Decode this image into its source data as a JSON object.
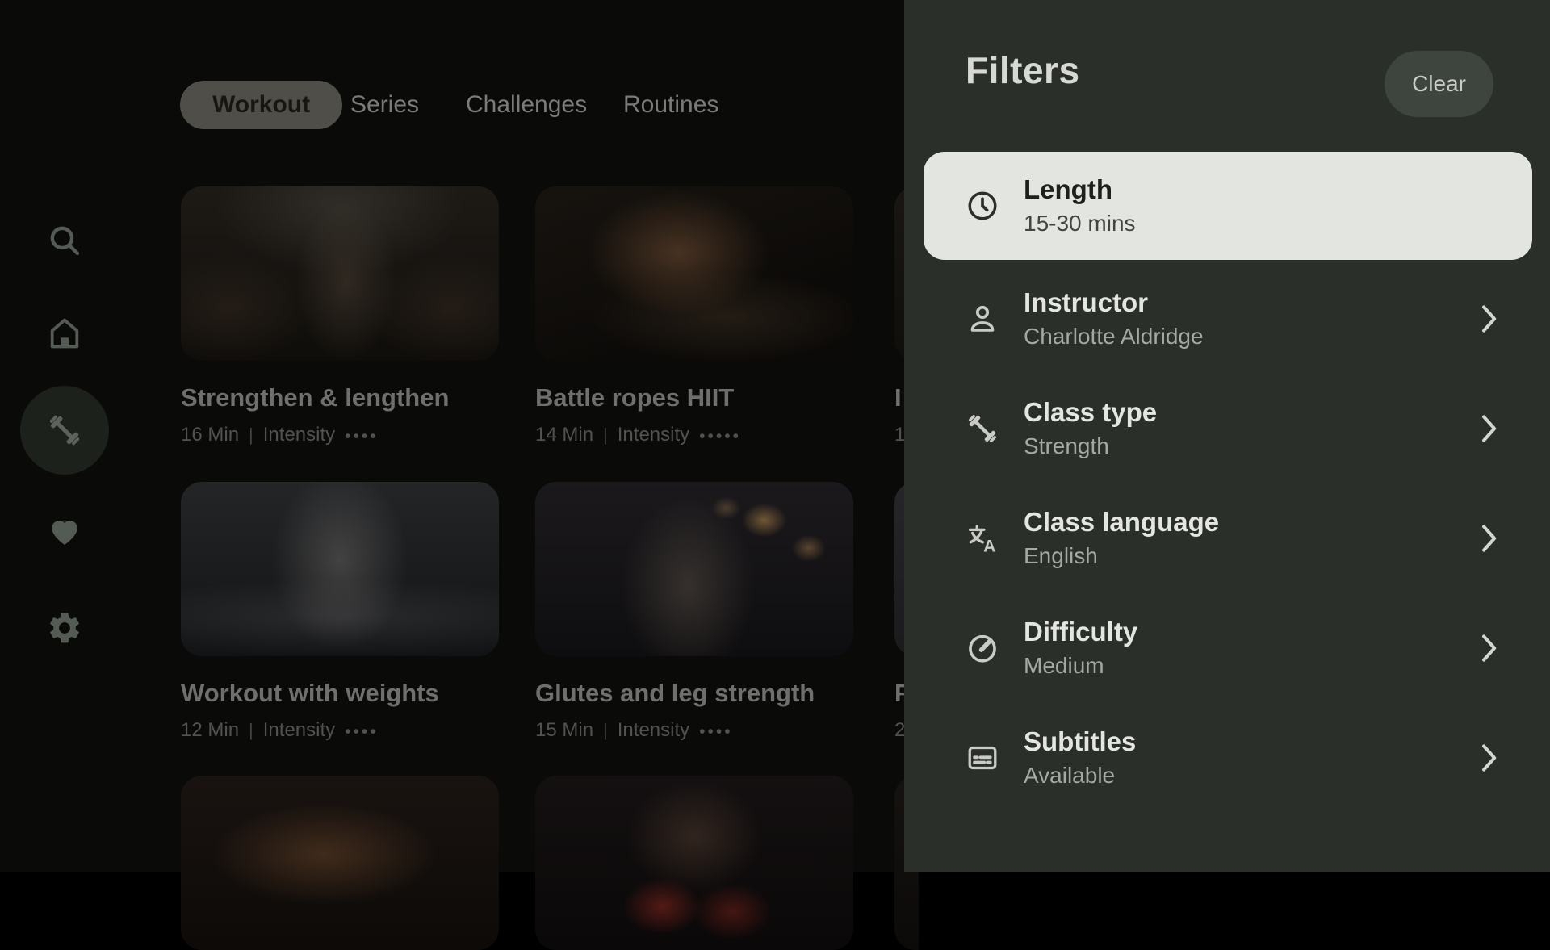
{
  "sidebar": {
    "items": [
      {
        "icon": "search",
        "active": false
      },
      {
        "icon": "home",
        "active": false
      },
      {
        "icon": "dumbbell",
        "active": true
      },
      {
        "icon": "heart",
        "active": false
      },
      {
        "icon": "settings",
        "active": false
      }
    ]
  },
  "tabs": [
    {
      "label": "Workout",
      "active": true
    },
    {
      "label": "Series",
      "active": false
    },
    {
      "label": "Challenges",
      "active": false
    },
    {
      "label": "Routines",
      "active": false
    }
  ],
  "cards": [
    {
      "title": "Strengthen & lengthen",
      "duration": "16 Min",
      "separator": "|",
      "intensity_label": "Intensity",
      "dots": 4
    },
    {
      "title": "Battle ropes HIIT",
      "duration": "14 Min",
      "separator": "|",
      "intensity_label": "Intensity",
      "dots": 5
    },
    {
      "title": "Workout with weights",
      "duration": "12 Min",
      "separator": "|",
      "intensity_label": "Intensity",
      "dots": 4
    },
    {
      "title": "Glutes and leg strength",
      "duration": "15 Min",
      "separator": "|",
      "intensity_label": "Intensity",
      "dots": 4
    },
    {
      "title_fragment": "I",
      "meta_fragment": "1"
    },
    {
      "title_fragment": "F",
      "meta_fragment": "2"
    }
  ],
  "filters_panel": {
    "title": "Filters",
    "clear_label": "Clear",
    "rows": [
      {
        "icon": "clock",
        "label": "Length",
        "value": "15-30 mins",
        "selected": true
      },
      {
        "icon": "person",
        "label": "Instructor",
        "value": "Charlotte Aldridge",
        "selected": false
      },
      {
        "icon": "dumbbell",
        "label": "Class type",
        "value": "Strength",
        "selected": false
      },
      {
        "icon": "translate",
        "label": "Class language",
        "value": "English",
        "selected": false
      },
      {
        "icon": "gauge",
        "label": "Difficulty",
        "value": "Medium",
        "selected": false
      },
      {
        "icon": "subtitles",
        "label": "Subtitles",
        "value": "Available",
        "selected": false
      }
    ]
  },
  "colors": {
    "app_background": "#0a0a08",
    "panel_background": "#2b2f2a",
    "selected_card_background": "#e3e5e0",
    "clear_button_background": "#3e443e",
    "row_label": "#e4e6e1",
    "row_value": "#a6a8a3",
    "selected_label": "#1d211c",
    "selected_value": "#41453f",
    "active_tab_pill": "#4f4e49"
  }
}
